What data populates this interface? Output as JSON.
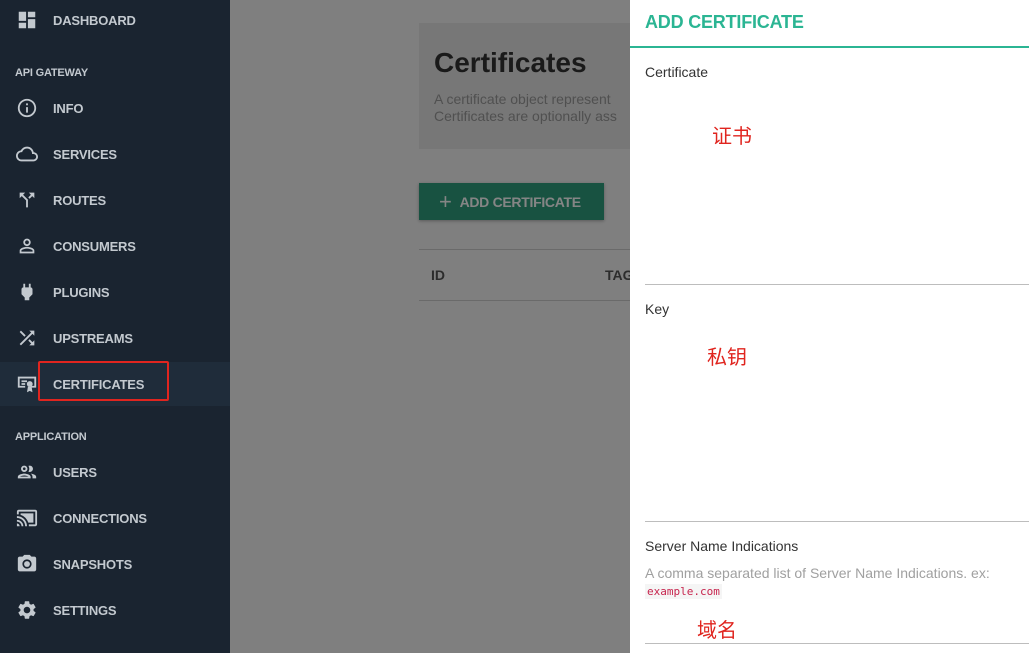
{
  "sidebar": {
    "items": [
      {
        "label": "DASHBOARD",
        "icon": "dashboard-icon"
      },
      {
        "label": "INFO",
        "icon": "info-icon"
      },
      {
        "label": "SERVICES",
        "icon": "cloud-icon"
      },
      {
        "label": "ROUTES",
        "icon": "routes-icon"
      },
      {
        "label": "CONSUMERS",
        "icon": "person-icon"
      },
      {
        "label": "PLUGINS",
        "icon": "plug-icon"
      },
      {
        "label": "UPSTREAMS",
        "icon": "shuffle-icon"
      },
      {
        "label": "CERTIFICATES",
        "icon": "certificate-icon"
      },
      {
        "label": "USERS",
        "icon": "users-icon"
      },
      {
        "label": "CONNECTIONS",
        "icon": "cast-icon"
      },
      {
        "label": "SNAPSHOTS",
        "icon": "camera-icon"
      },
      {
        "label": "SETTINGS",
        "icon": "gear-icon"
      }
    ],
    "sections": {
      "api_gateway": "API GATEWAY",
      "application": "APPLICATION"
    },
    "active": "CERTIFICATES"
  },
  "main": {
    "title": "Certificates",
    "description_line1": "A certificate object represent",
    "description_line2": "Certificates are optionally ass",
    "add_button": "ADD CERTIFICATE",
    "columns": [
      "ID",
      "TAG"
    ]
  },
  "panel": {
    "title": "ADD CERTIFICATE",
    "certificate_label": "Certificate",
    "certificate_note": "证书",
    "key_label": "Key",
    "key_note": "私钥",
    "sni_label": "Server Name Indications",
    "sni_help": "A comma separated list of Server Name Indications. ex:",
    "sni_example": "example.com",
    "sni_note": "域名"
  },
  "colors": {
    "sidebar_bg": "#1a2430",
    "accent": "#2bb593",
    "button": "#2e9e7d",
    "annotation": "#e0251f"
  }
}
